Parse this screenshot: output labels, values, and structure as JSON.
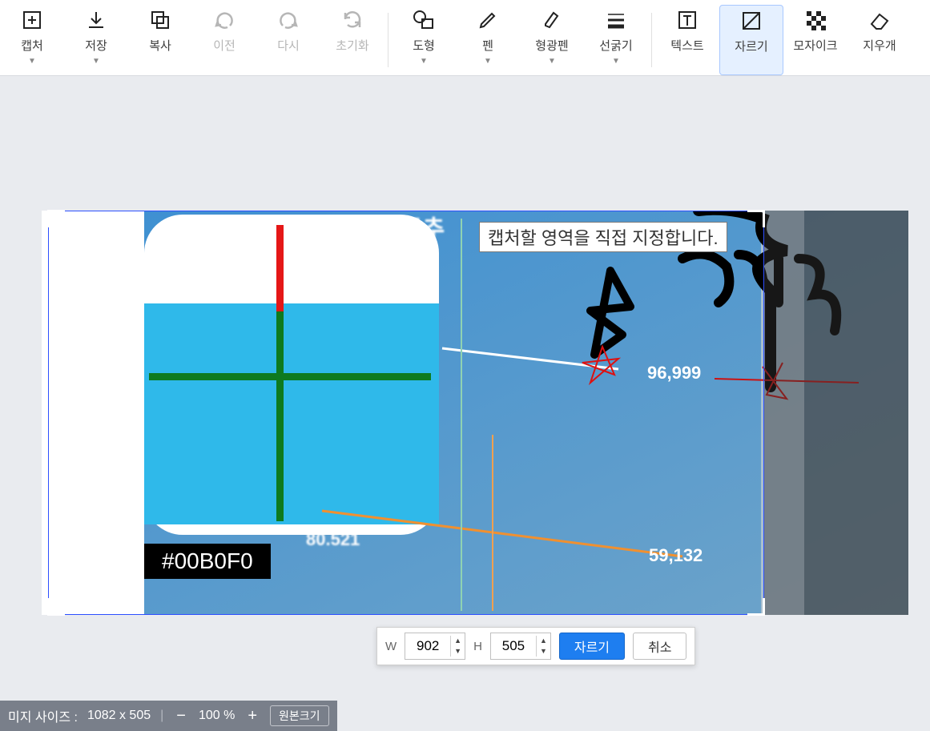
{
  "toolbar": {
    "items": [
      {
        "id": "recapture",
        "label": "캡처",
        "icon": "plus-frame-icon",
        "disabled": false,
        "arrow": true
      },
      {
        "id": "save",
        "label": "저장",
        "icon": "download-icon",
        "disabled": false,
        "arrow": true
      },
      {
        "id": "copy",
        "label": "복사",
        "icon": "copy-icon",
        "disabled": false,
        "arrow": false
      },
      {
        "id": "undo",
        "label": "이전",
        "icon": "undo-icon",
        "disabled": true,
        "arrow": false
      },
      {
        "id": "redo",
        "label": "다시",
        "icon": "redo-icon",
        "disabled": true,
        "arrow": false
      },
      {
        "id": "reset",
        "label": "초기화",
        "icon": "reset-icon",
        "disabled": true,
        "arrow": false
      },
      {
        "sep": true
      },
      {
        "id": "shape",
        "label": "도형",
        "icon": "shape-icon",
        "disabled": false,
        "arrow": true
      },
      {
        "id": "pen",
        "label": "펜",
        "icon": "pen-icon",
        "disabled": false,
        "arrow": true
      },
      {
        "id": "highlight",
        "label": "형광펜",
        "icon": "highlighter-icon",
        "disabled": false,
        "arrow": true
      },
      {
        "id": "lineweight",
        "label": "선굵기",
        "icon": "line-weight-icon",
        "disabled": false,
        "arrow": true
      },
      {
        "sep": true
      },
      {
        "id": "text",
        "label": "텍스트",
        "icon": "text-icon",
        "disabled": false,
        "arrow": false
      },
      {
        "id": "crop",
        "label": "자르기",
        "icon": "crop-icon",
        "disabled": false,
        "arrow": false,
        "active": true
      },
      {
        "id": "mosaic",
        "label": "모자이크",
        "icon": "mosaic-icon",
        "disabled": false,
        "arrow": false
      },
      {
        "id": "eraser",
        "label": "지우개",
        "icon": "eraser-icon",
        "disabled": false,
        "arrow": false
      }
    ]
  },
  "tooltip": "캡처할 영역을 직접 지정합니다.",
  "canvas": {
    "color_picker_hex": "#00B0F0",
    "data_labels": [
      "96,999",
      "59,132",
      "80.521",
      "공추"
    ]
  },
  "crop_bar": {
    "w_label": "W",
    "h_label": "H",
    "width": "902",
    "height": "505",
    "crop_btn": "자르기",
    "cancel_btn": "취소"
  },
  "status": {
    "size_label": "미지 사이즈 :",
    "size_value": "1082 x 505",
    "zoom": "100 %",
    "original_size_btn": "원본크기"
  }
}
